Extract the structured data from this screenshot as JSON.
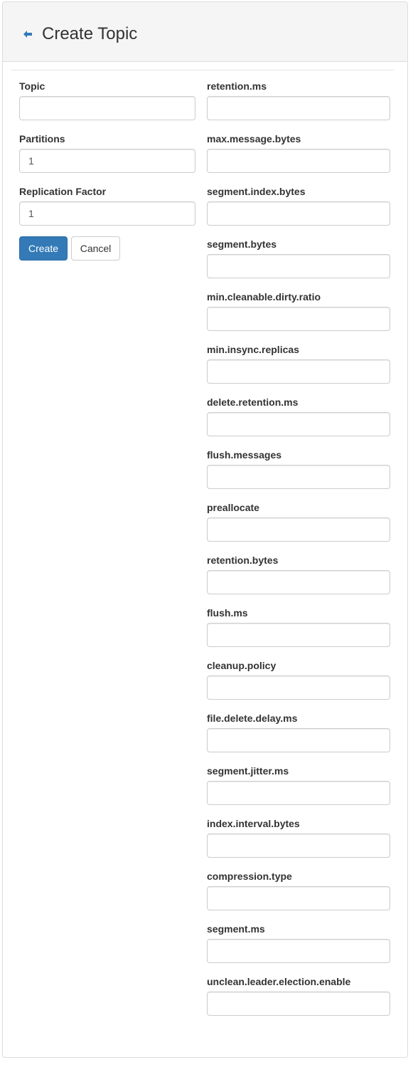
{
  "header": {
    "title": "Create Topic",
    "back_icon": "arrow-left-icon"
  },
  "form": {
    "left_fields": [
      {
        "label": "Topic",
        "value": ""
      },
      {
        "label": "Partitions",
        "value": "1"
      },
      {
        "label": "Replication Factor",
        "value": "1"
      }
    ],
    "buttons": {
      "create": "Create",
      "cancel": "Cancel"
    },
    "config_fields": [
      {
        "label": "retention.ms",
        "value": ""
      },
      {
        "label": "max.message.bytes",
        "value": ""
      },
      {
        "label": "segment.index.bytes",
        "value": ""
      },
      {
        "label": "segment.bytes",
        "value": ""
      },
      {
        "label": "min.cleanable.dirty.ratio",
        "value": ""
      },
      {
        "label": "min.insync.replicas",
        "value": ""
      },
      {
        "label": "delete.retention.ms",
        "value": ""
      },
      {
        "label": "flush.messages",
        "value": ""
      },
      {
        "label": "preallocate",
        "value": ""
      },
      {
        "label": "retention.bytes",
        "value": ""
      },
      {
        "label": "flush.ms",
        "value": ""
      },
      {
        "label": "cleanup.policy",
        "value": ""
      },
      {
        "label": "file.delete.delay.ms",
        "value": ""
      },
      {
        "label": "segment.jitter.ms",
        "value": ""
      },
      {
        "label": "index.interval.bytes",
        "value": ""
      },
      {
        "label": "compression.type",
        "value": ""
      },
      {
        "label": "segment.ms",
        "value": ""
      },
      {
        "label": "unclean.leader.election.enable",
        "value": ""
      }
    ]
  },
  "colors": {
    "primary": "#337ab7",
    "header_bg": "#f5f5f5",
    "border": "#dddddd"
  }
}
